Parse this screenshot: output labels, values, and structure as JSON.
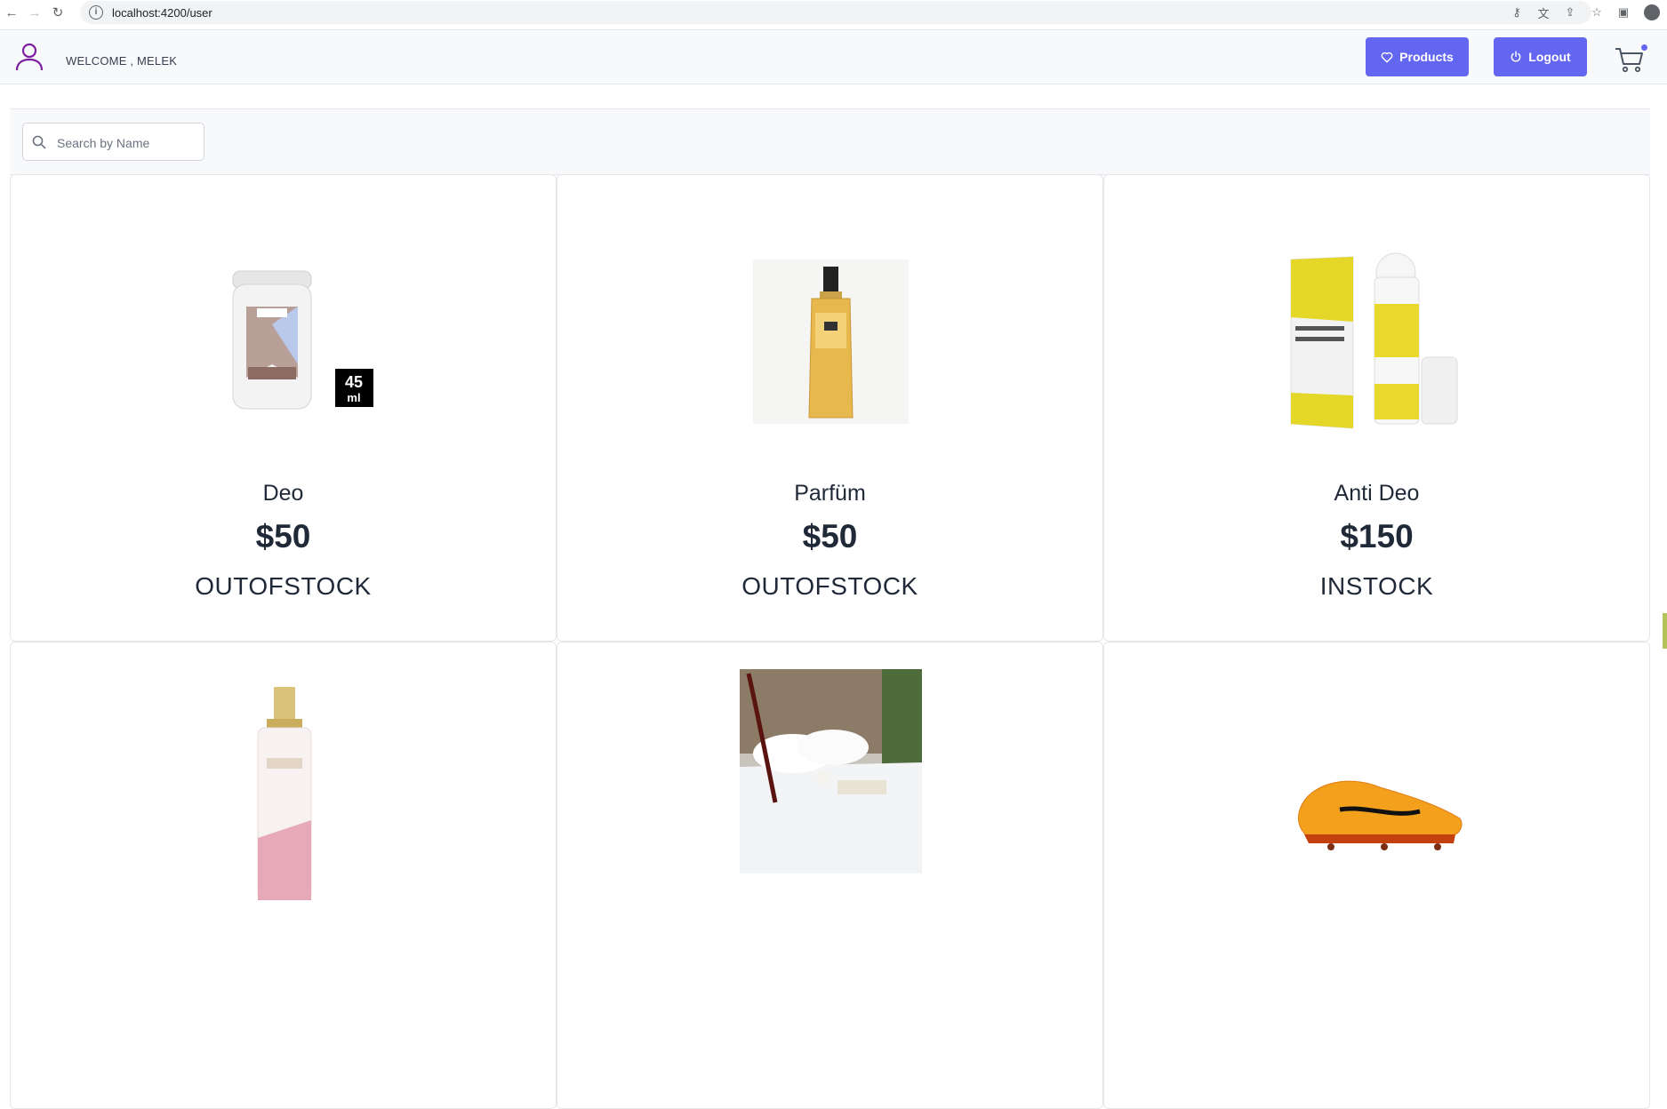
{
  "browser": {
    "url": "localhost:4200/user"
  },
  "header": {
    "welcome": "WELCOME , MELEK",
    "products_label": "Products",
    "logout_label": "Logout"
  },
  "search": {
    "placeholder": "Search by Name",
    "value": ""
  },
  "products": [
    {
      "name": "Deo",
      "price": "$50",
      "status": "OUTOFSTOCK",
      "image": "deodorant-stick",
      "badge": "45\nml"
    },
    {
      "name": "Parfüm",
      "price": "$50",
      "status": "OUTOFSTOCK",
      "image": "perfume-bottle"
    },
    {
      "name": "Anti Deo",
      "price": "$150",
      "status": "INSTOCK",
      "image": "roll-on-deodorant"
    },
    {
      "name": "",
      "price": "",
      "status": "",
      "image": "hair-mist-bottle"
    },
    {
      "name": "",
      "price": "",
      "status": "",
      "image": "mattress-protector"
    },
    {
      "name": "",
      "price": "",
      "status": "",
      "image": "football-boot"
    }
  ],
  "colors": {
    "accent": "#6366f1",
    "user_icon": "#7b1fa2"
  }
}
